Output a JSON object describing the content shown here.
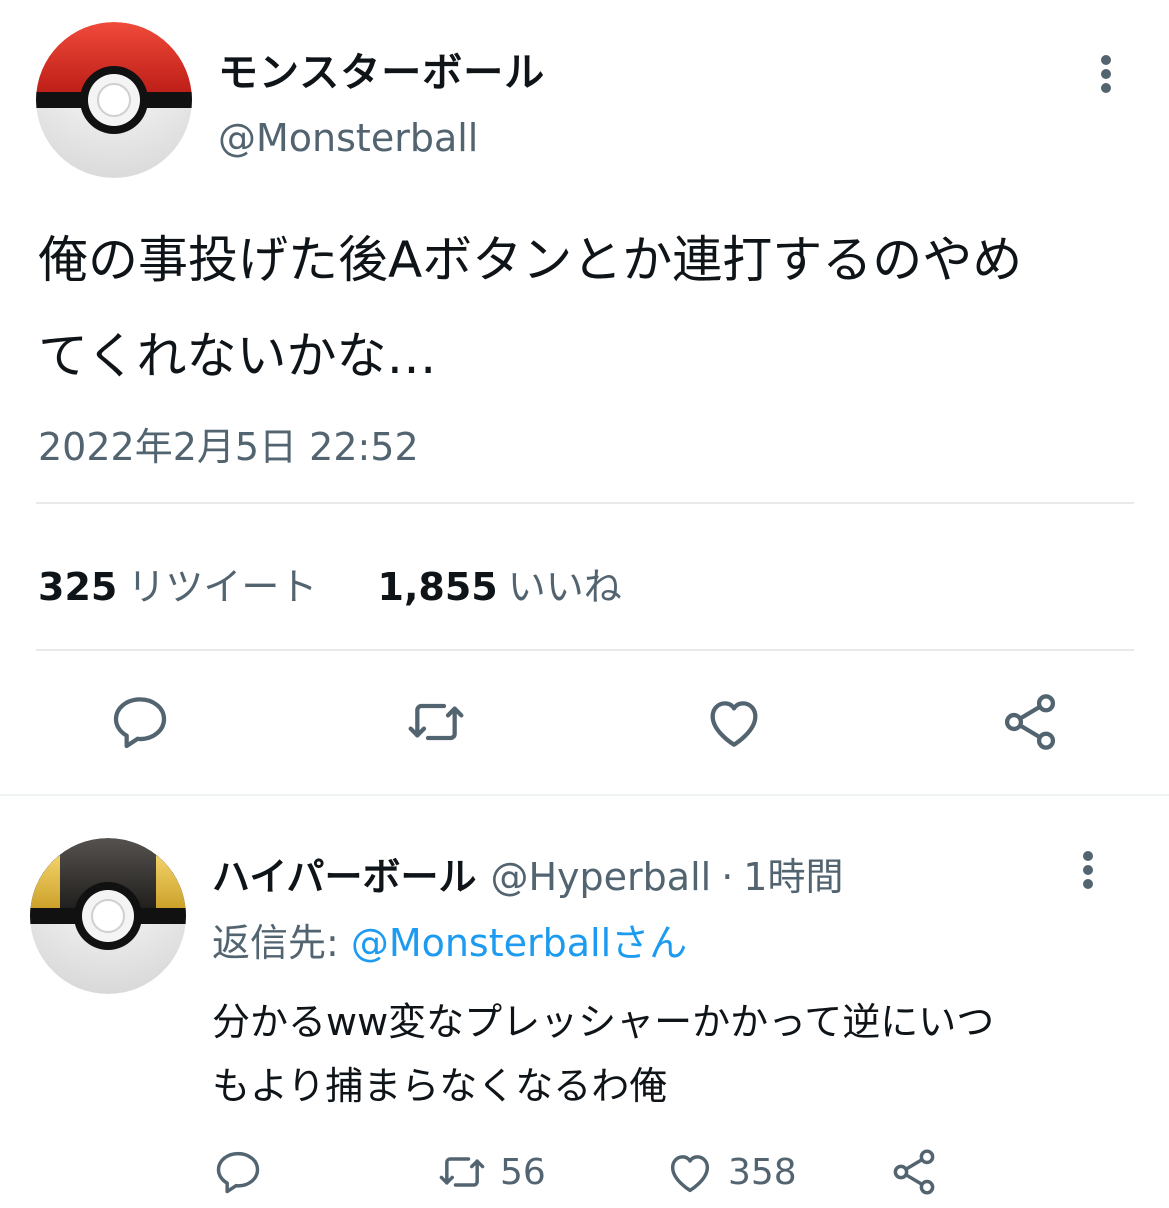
{
  "main_tweet": {
    "display_name": "モンスターボール",
    "handle": "@Monsterball",
    "text_line1": "俺の事投げた後Aボタンとか連打するのやめ",
    "text_line2": "てくれないかな…",
    "timestamp": "2022年2月5日 22:52",
    "retweet_count": "325",
    "retweet_label": "リツイート",
    "like_count": "1,855",
    "like_label": "いいね",
    "avatar_icon": "monster-ball-avatar",
    "actions": [
      "reply-icon",
      "retweet-icon",
      "like-icon",
      "share-icon"
    ]
  },
  "reply_tweet": {
    "display_name": "ハイパーボール",
    "handle": "@Hyperball",
    "separator": "·",
    "time": "1時間",
    "reply_to_label": "返信先:",
    "reply_to_handle": "@Monsterballさん",
    "text_line1": "分かるww変なプレッシャーかかって逆にいつ",
    "text_line2": "もより捕まらなくなるわ俺",
    "retweet_count": "56",
    "like_count": "358",
    "avatar_icon": "hyper-ball-avatar"
  },
  "colors": {
    "text_primary": "#0f1419",
    "text_secondary": "#536471",
    "link": "#1d9bf0",
    "divider": "#e7e9ea"
  }
}
